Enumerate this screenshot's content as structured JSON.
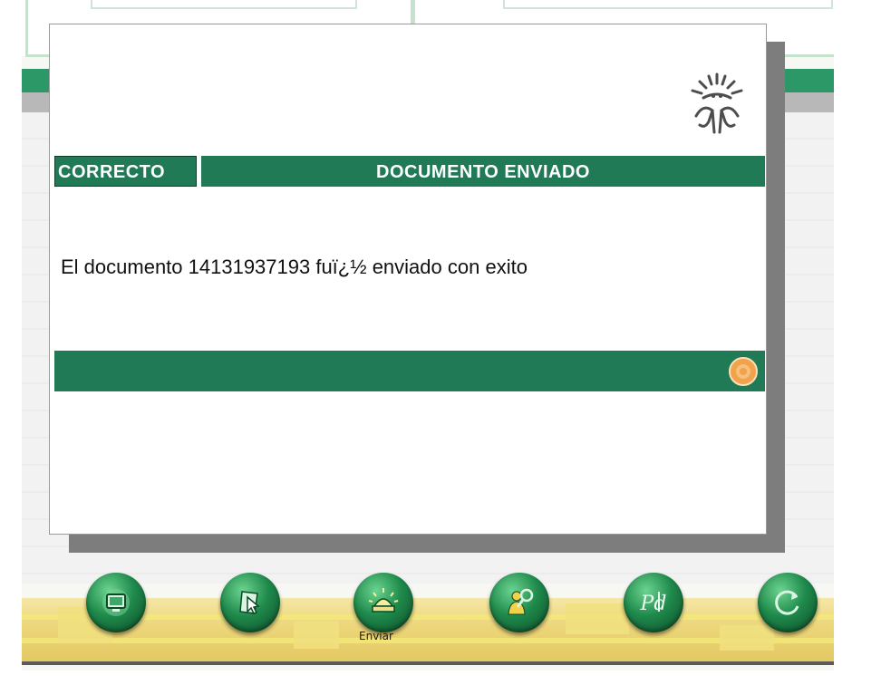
{
  "colors": {
    "dialog_green": "#1f7a55",
    "toolbar_yellow": "#ecd67a",
    "button_green": "#1f8a4c",
    "ok_orange": "#f0a24c"
  },
  "dialog": {
    "status_label": "CORRECTO",
    "title": "DOCUMENTO ENVIADO",
    "message": "El documento 14131937193 fuï¿½ enviado con exito",
    "logo_icon": "abstract-figure-logo-icon",
    "ok_icon": "orange-circle-icon"
  },
  "toolbar": {
    "buttons": [
      {
        "icon": "screen-icon",
        "label": ""
      },
      {
        "icon": "document-pointer-icon",
        "label": ""
      },
      {
        "icon": "send-alarm-icon",
        "label": "Enviar"
      },
      {
        "icon": "person-magnifier-icon",
        "label": ""
      },
      {
        "icon": "pdf-icon",
        "label": ""
      },
      {
        "icon": "refresh-icon",
        "label": ""
      }
    ]
  }
}
